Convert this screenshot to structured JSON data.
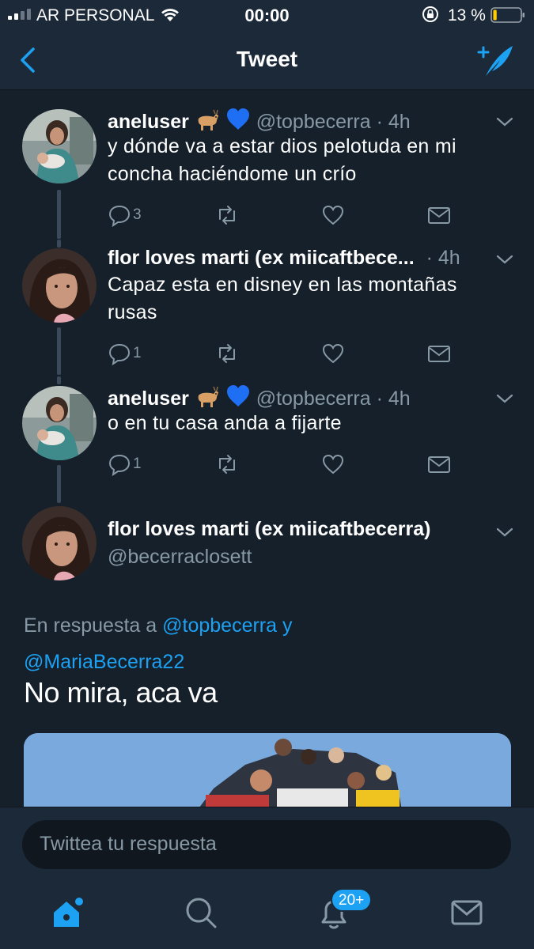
{
  "status_bar": {
    "carrier": "AR PERSONAL",
    "time": "00:00",
    "battery_percent": "13 %",
    "battery_level": 0.13
  },
  "header": {
    "title": "Tweet",
    "back_icon": "chevron-left-icon",
    "compose_icon": "compose-tweet-icon"
  },
  "thread": [
    {
      "name": "aneluser",
      "emoji": "goat 💙",
      "handle": "@topbecerra",
      "time": "· 4h",
      "text_lines": [
        "y dónde va a estar dios pelotuda en mi",
        "concha haciéndome un crío"
      ],
      "reply_count": "3",
      "retweet_count": "",
      "like_count": ""
    },
    {
      "name": "flor loves marti (ex miicaftbece...",
      "emoji": "",
      "handle": "",
      "time": "· 4h",
      "text_lines": [
        "Capaz esta en disney en las montañas",
        "rusas"
      ],
      "reply_count": "1",
      "retweet_count": "",
      "like_count": ""
    },
    {
      "name": "aneluser",
      "emoji": "goat 💙",
      "handle": "@topbecerra",
      "time": "· 4h",
      "text_lines": [
        "o en tu casa anda a fijarte"
      ],
      "reply_count": "1",
      "retweet_count": "",
      "like_count": ""
    }
  ],
  "main_tweet": {
    "name": "flor loves marti (ex miicaftbecerra)",
    "handle": "@becerraclosett",
    "reply_prefix": "En respuesta a",
    "reply_user_1": "@topbecerra",
    "reply_joiner": "y",
    "reply_user_2": "@MariaBecerra22",
    "text": "No mira, aca va"
  },
  "reply_bar": {
    "placeholder": "Twittea tu respuesta"
  },
  "tab_bar": {
    "notifications_badge": "20+",
    "tabs": [
      "home-icon",
      "search-icon",
      "notifications-bell-icon",
      "messages-icon"
    ]
  },
  "colors": {
    "background": "#15202b",
    "bar": "#1c2938",
    "accent": "#1da1f2",
    "secondary_text": "#8899a6"
  }
}
